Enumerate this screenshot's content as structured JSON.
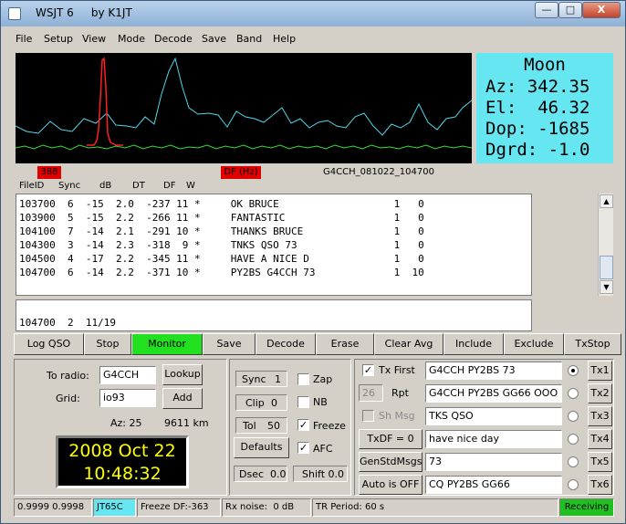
{
  "window": {
    "title": "WSJT 6     by K1JT"
  },
  "titlebar_buttons": {
    "minimize": "—",
    "maximize": "□",
    "close": "X"
  },
  "menu": [
    "File",
    "Setup",
    "View",
    "Mode",
    "Decode",
    "Save",
    "Band",
    "Help"
  ],
  "moon": {
    "title": "Moon",
    "lines": [
      "Az: 342.35",
      "El:  46.32",
      "Dop: -1685",
      "Dgrd: -1.0"
    ],
    "bg": "#66e6f0"
  },
  "spectrum": {
    "colors": {
      "cyan": "#52d6ea",
      "red": "#ff2020",
      "green": "#35e035"
    }
  },
  "scale": {
    "marker1": "388",
    "marker2": "DF (Hz)",
    "filename": "G4CCH_081022_104700"
  },
  "decode_header": [
    "FileID",
    "Sync",
    "dB",
    "DT",
    "DF",
    "W"
  ],
  "decodes": [
    "103700  6  -15  2.0  -237 11 *     OK BRUCE                   1   0",
    "103900  5  -15  2.2  -266 11 *     FANTASTIC                  1   0",
    "104100  7  -14  2.1  -291 10 *     THANKS BRUCE               1   0",
    "104300  3  -14  2.3  -318  9 *     TNKS QSO 73                1   0",
    "104500  4  -17  2.2  -345 11 *     HAVE A NICE D              1   0",
    "104700  6  -14  2.2  -371 10 *     PY2BS G4CCH 73             1  10"
  ],
  "average": "104700  2  11/19",
  "buttons": {
    "log_qso": "Log QSO",
    "stop": "Stop",
    "monitor": "Monitor",
    "save": "Save",
    "decode": "Decode",
    "erase": "Erase",
    "clear_avg": "Clear Avg",
    "include": "Include",
    "exclude": "Exclude",
    "txstop": "TxStop"
  },
  "station": {
    "to_radio_label": "To radio:",
    "to_radio": "G4CCH",
    "lookup": "Lookup",
    "grid_label": "Grid:",
    "grid": "io93",
    "add": "Add",
    "az": "Az: 25",
    "distance": "9611 km"
  },
  "clock": {
    "date": "2008 Oct 22",
    "time": "10:48:32",
    "color": "#ffff00"
  },
  "controls": {
    "sync_label": "Sync",
    "sync_value": "1",
    "clip_label": "Clip",
    "clip_value": "0",
    "tol_label": "Tol",
    "tol_value": "50",
    "defaults": "Defaults",
    "dsec": "Dsec  0.0",
    "shift": "Shift 0.0",
    "zap": "Zap",
    "nb": "NB",
    "freeze": "Freeze",
    "afc": "AFC",
    "zap_checked": false,
    "nb_checked": false,
    "freeze_checked": true,
    "afc_checked": true
  },
  "tx": {
    "tx_first_label": "Tx First",
    "tx_first_checked": true,
    "rpt_value": "26",
    "rpt_label": "Rpt",
    "sh_msg_label": "Sh Msg",
    "sh_msg_checked": false,
    "txdf": "TxDF = 0",
    "genstd": "GenStdMsgs",
    "auto": "Auto is OFF",
    "messages": [
      "G4CCH PY2BS 73",
      "G4CCH PY2BS GG66 OOO",
      "TKS QSO",
      "have nice day",
      "73",
      "CQ PY2BS GG66"
    ],
    "buttons": [
      "Tx1",
      "Tx2",
      "Tx3",
      "Tx4",
      "Tx5",
      "Tx6"
    ],
    "selected": 0
  },
  "status": {
    "dt": "0.9999 0.9998",
    "mode": "JT65C",
    "freeze": "Freeze DF:-363",
    "rx_noise": "Rx noise:  0 dB",
    "tr_period": "TR Period: 60 s",
    "state": "Receiving",
    "mode_color": "#66e6f0",
    "state_color": "#20c020"
  }
}
